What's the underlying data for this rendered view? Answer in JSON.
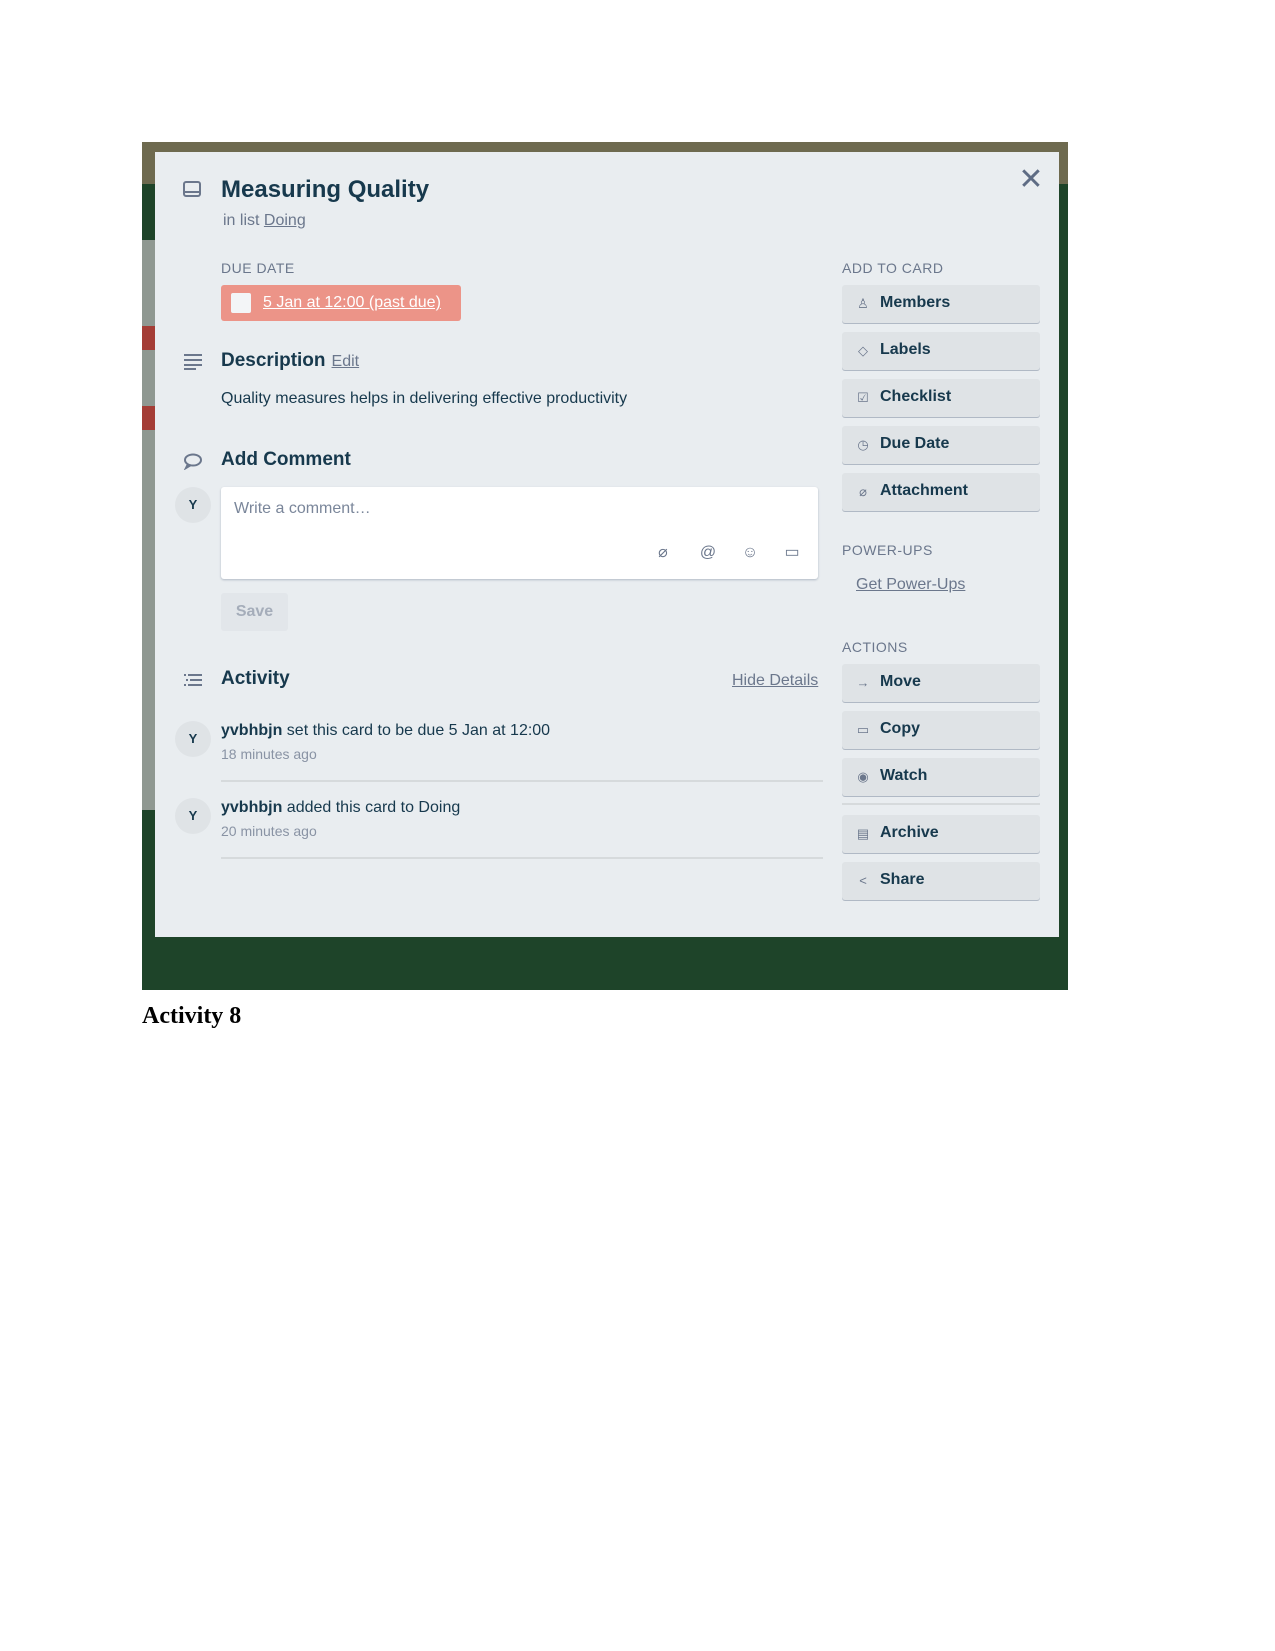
{
  "card": {
    "title": "Measuring Quality",
    "in_list_prefix": "in list",
    "list_name": "Doing",
    "close_glyph": "✕"
  },
  "due_date": {
    "label": "DUE DATE",
    "value": "5 Jan at 12:00 (past due)",
    "status_color": "#ec9488"
  },
  "description": {
    "title": "Description",
    "edit_label": "Edit",
    "text": "Quality measures helps in delivering effective productivity"
  },
  "comment": {
    "title": "Add Comment",
    "avatar_initial": "Y",
    "placeholder": "Write a comment…",
    "tools": [
      "attachment-icon",
      "mention-icon",
      "emoji-icon",
      "card-icon"
    ],
    "tool_glyphs": [
      "⌀",
      "@",
      "☺",
      "▭"
    ],
    "save_label": "Save"
  },
  "activity": {
    "title": "Activity",
    "hide_details_label": "Hide Details",
    "items": [
      {
        "avatar": "Y",
        "user": "yvbhbjn",
        "action": " set this card to be due 5 Jan at 12:00",
        "time": "18 minutes ago"
      },
      {
        "avatar": "Y",
        "user": "yvbhbjn",
        "action": " added this card to Doing",
        "time": "20 minutes ago"
      }
    ]
  },
  "sidebar": {
    "add_to_card_label": "ADD TO CARD",
    "add_to_card": [
      {
        "label": "Members",
        "icon": "person-icon",
        "glyph": "♙"
      },
      {
        "label": "Labels",
        "icon": "tag-icon",
        "glyph": "◇"
      },
      {
        "label": "Checklist",
        "icon": "checklist-icon",
        "glyph": "☑"
      },
      {
        "label": "Due Date",
        "icon": "clock-icon",
        "glyph": "◷"
      },
      {
        "label": "Attachment",
        "icon": "paperclip-icon",
        "glyph": "⌀"
      }
    ],
    "powerups_label": "POWER-UPS",
    "get_powerups_label": "Get Power-Ups",
    "actions_label": "ACTIONS",
    "actions": [
      {
        "label": "Move",
        "icon": "arrow-right-icon",
        "glyph": "→"
      },
      {
        "label": "Copy",
        "icon": "copy-icon",
        "glyph": "▭"
      },
      {
        "label": "Watch",
        "icon": "eye-icon",
        "glyph": "◉"
      },
      {
        "label": "Archive",
        "icon": "archive-icon",
        "glyph": "▤"
      },
      {
        "label": "Share",
        "icon": "share-icon",
        "glyph": "<"
      }
    ]
  },
  "caption": "Activity 8"
}
